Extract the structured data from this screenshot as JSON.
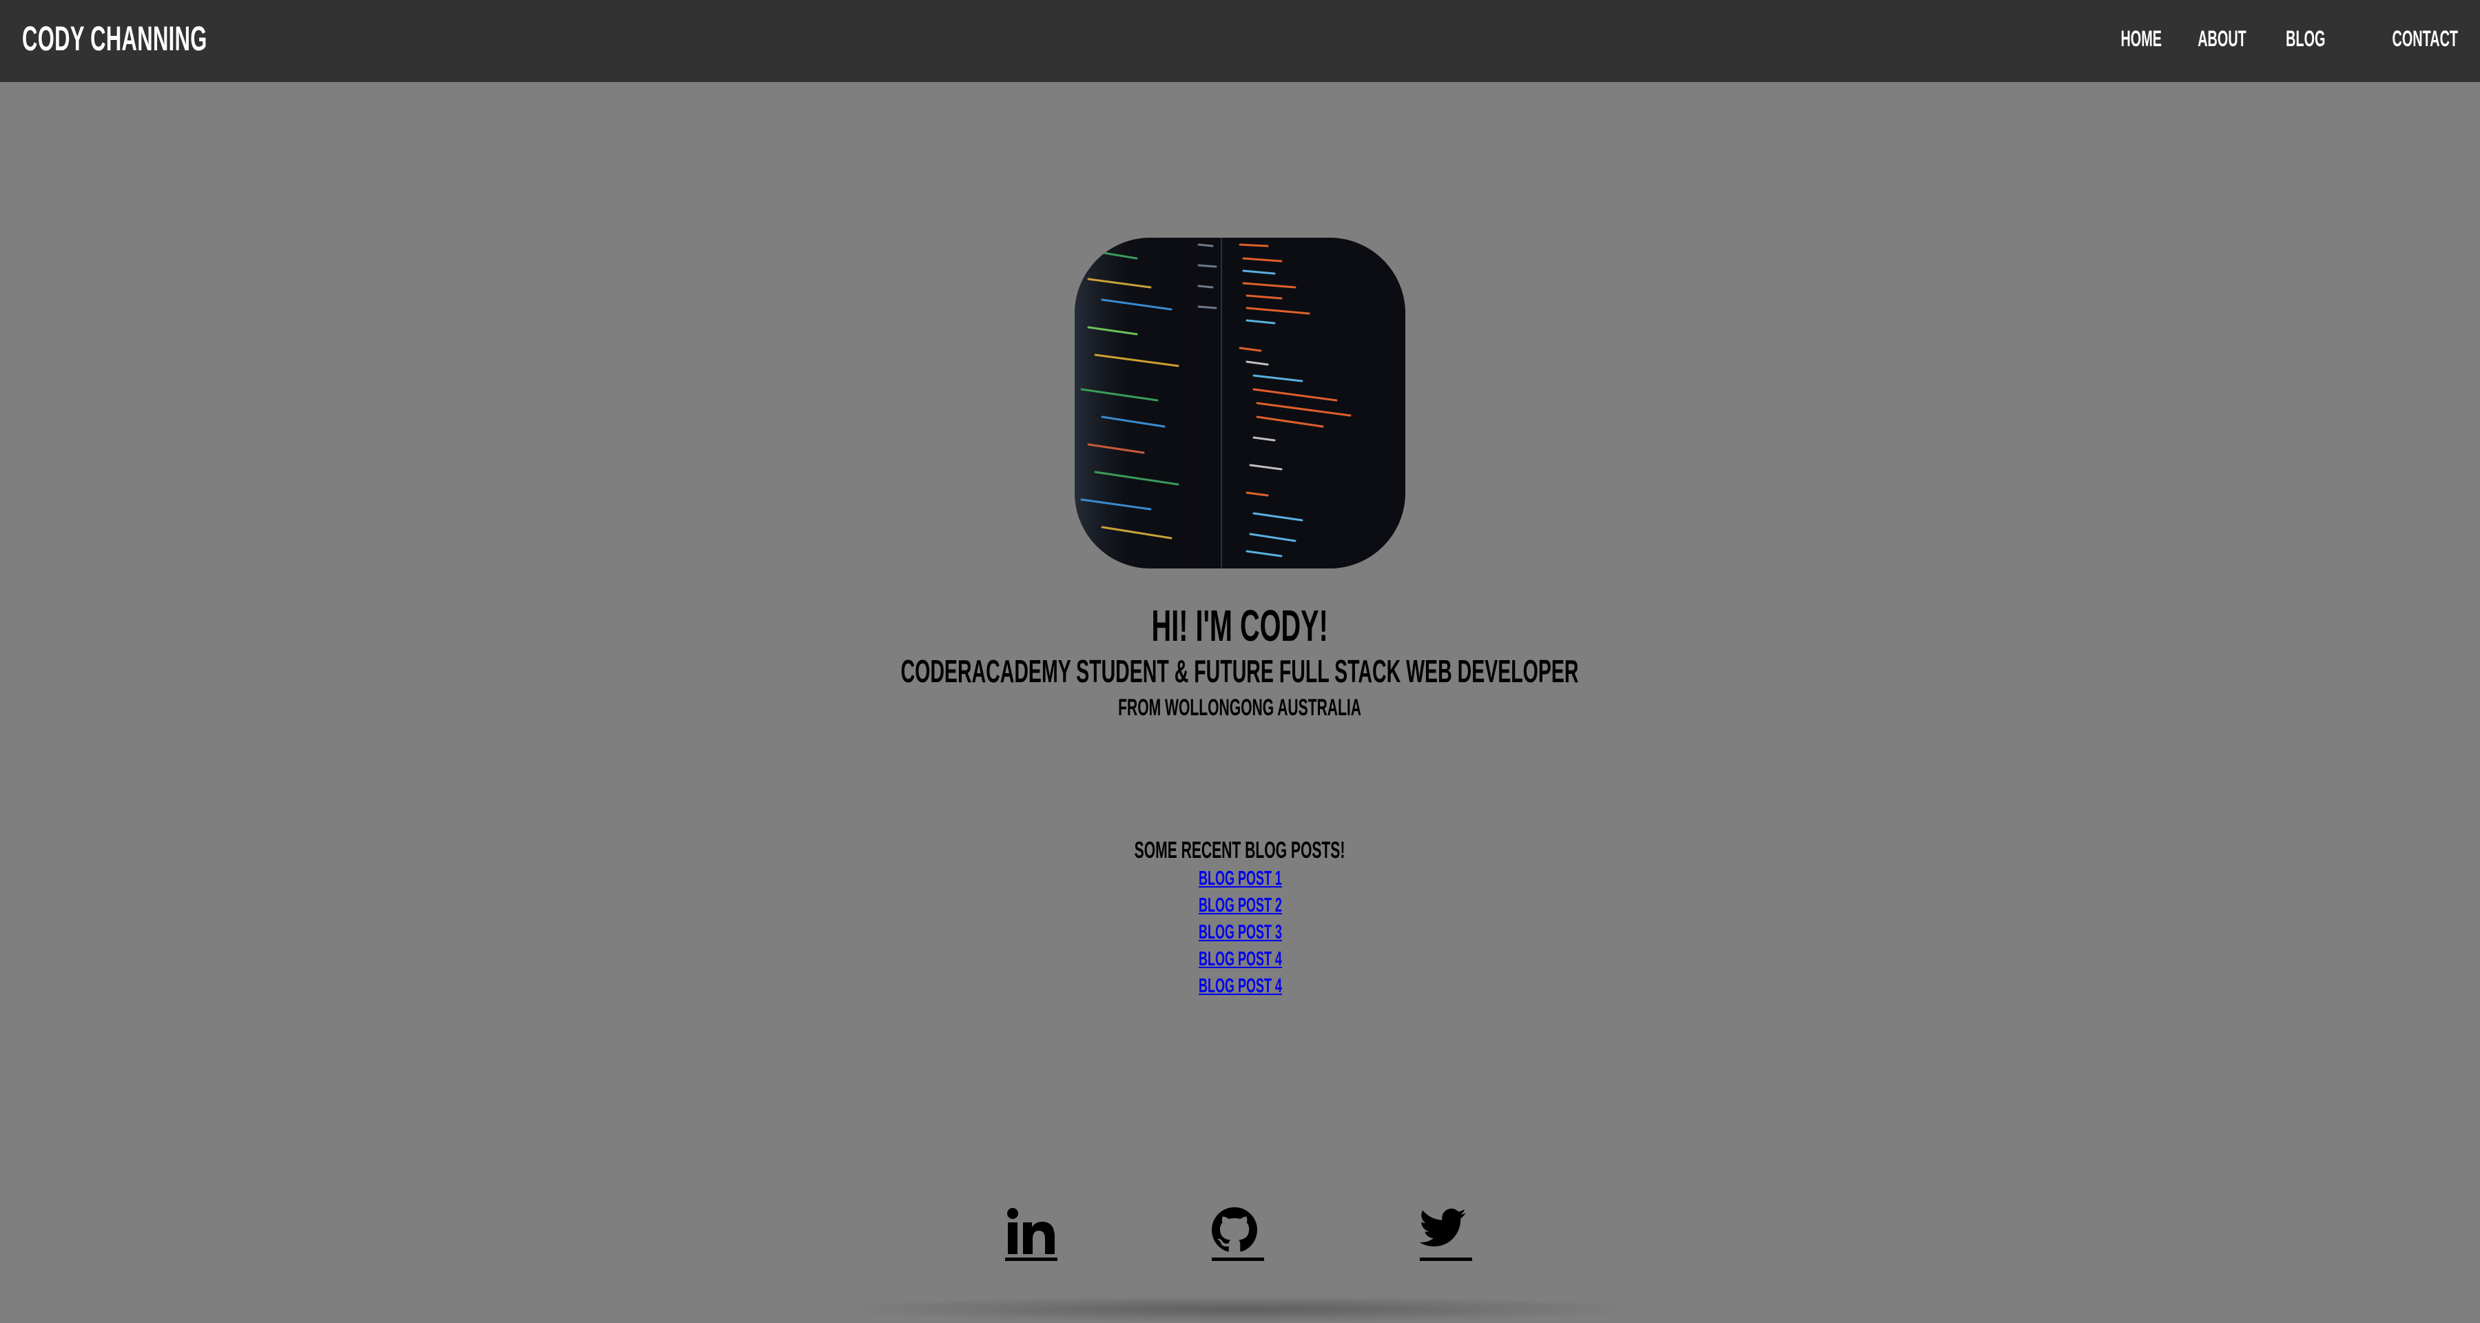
{
  "navbar": {
    "brand": "CODY CHANNING",
    "links": [
      {
        "label": "HOME"
      },
      {
        "label": "ABOUT"
      },
      {
        "label": "BLOG"
      },
      {
        "label": "CONTACT"
      }
    ]
  },
  "hero": {
    "image": "code-editor-photo",
    "greeting": "HI! I'M CODY!",
    "tagline": "CODERACADEMY STUDENT & FUTURE FULL STACK WEB DEVELOPER",
    "location": "FROM WOLLONGONG AUSTRALIA"
  },
  "blog": {
    "heading": "SOME RECENT BLOG POSTS!",
    "posts": [
      {
        "label": "BLOG POST 1"
      },
      {
        "label": "BLOG POST 2"
      },
      {
        "label": "BLOG POST 3"
      },
      {
        "label": "BLOG POST 4"
      },
      {
        "label": "BLOG POST 4"
      }
    ]
  },
  "social": {
    "icons": [
      "linkedin-icon",
      "github-icon",
      "twitter-icon"
    ]
  },
  "colors": {
    "navbar_bg": "#323232",
    "page_bg": "#7f7f7f",
    "link": "#0000ee",
    "text": "#000000"
  }
}
